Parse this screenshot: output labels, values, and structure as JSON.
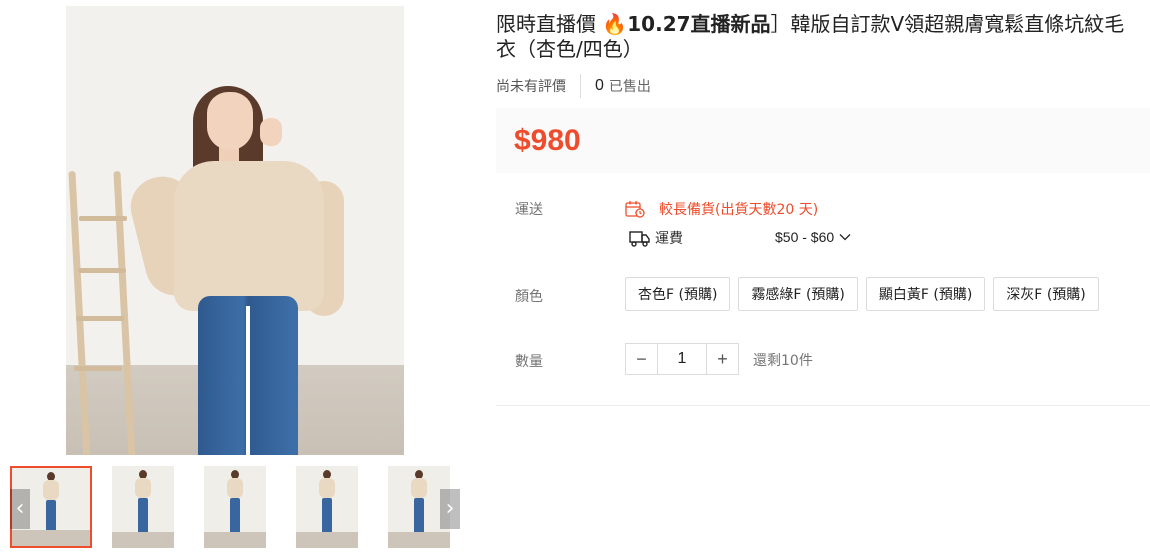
{
  "product": {
    "title_prefix": "限時直播價 ",
    "title_emoji": "🔥",
    "title_bold": "10.27直播新品",
    "title_rest": "］韓版自訂款V領超親膚寬鬆直條坑紋毛衣（杏色/四色）",
    "rating_text": "尚未有評價",
    "sold_count": "0",
    "sold_label": "已售出",
    "price": "$980"
  },
  "shipping": {
    "label": "運送",
    "warning_icon": "calendar-clock-icon",
    "warning_text": "較長備貨(出貨天數20 天)",
    "fee_icon": "truck-icon",
    "fee_label": "運費",
    "fee_value": "$50 - $60"
  },
  "color": {
    "label": "顏色",
    "options": [
      "杏色F (預購)",
      "霧感綠F (預購)",
      "顯白黃F (預購)",
      "深灰F (預購)"
    ]
  },
  "quantity": {
    "label": "數量",
    "value": "1",
    "decrease": "−",
    "increase": "+",
    "stock_text": "還剩10件"
  },
  "gallery": {
    "prev_icon": "chevron-left-icon",
    "next_icon": "chevron-right-icon",
    "prev_glyph": "‹",
    "next_glyph": "›"
  },
  "colors": {
    "accent": "#ee4d2d",
    "price_bg": "#fafafa"
  }
}
